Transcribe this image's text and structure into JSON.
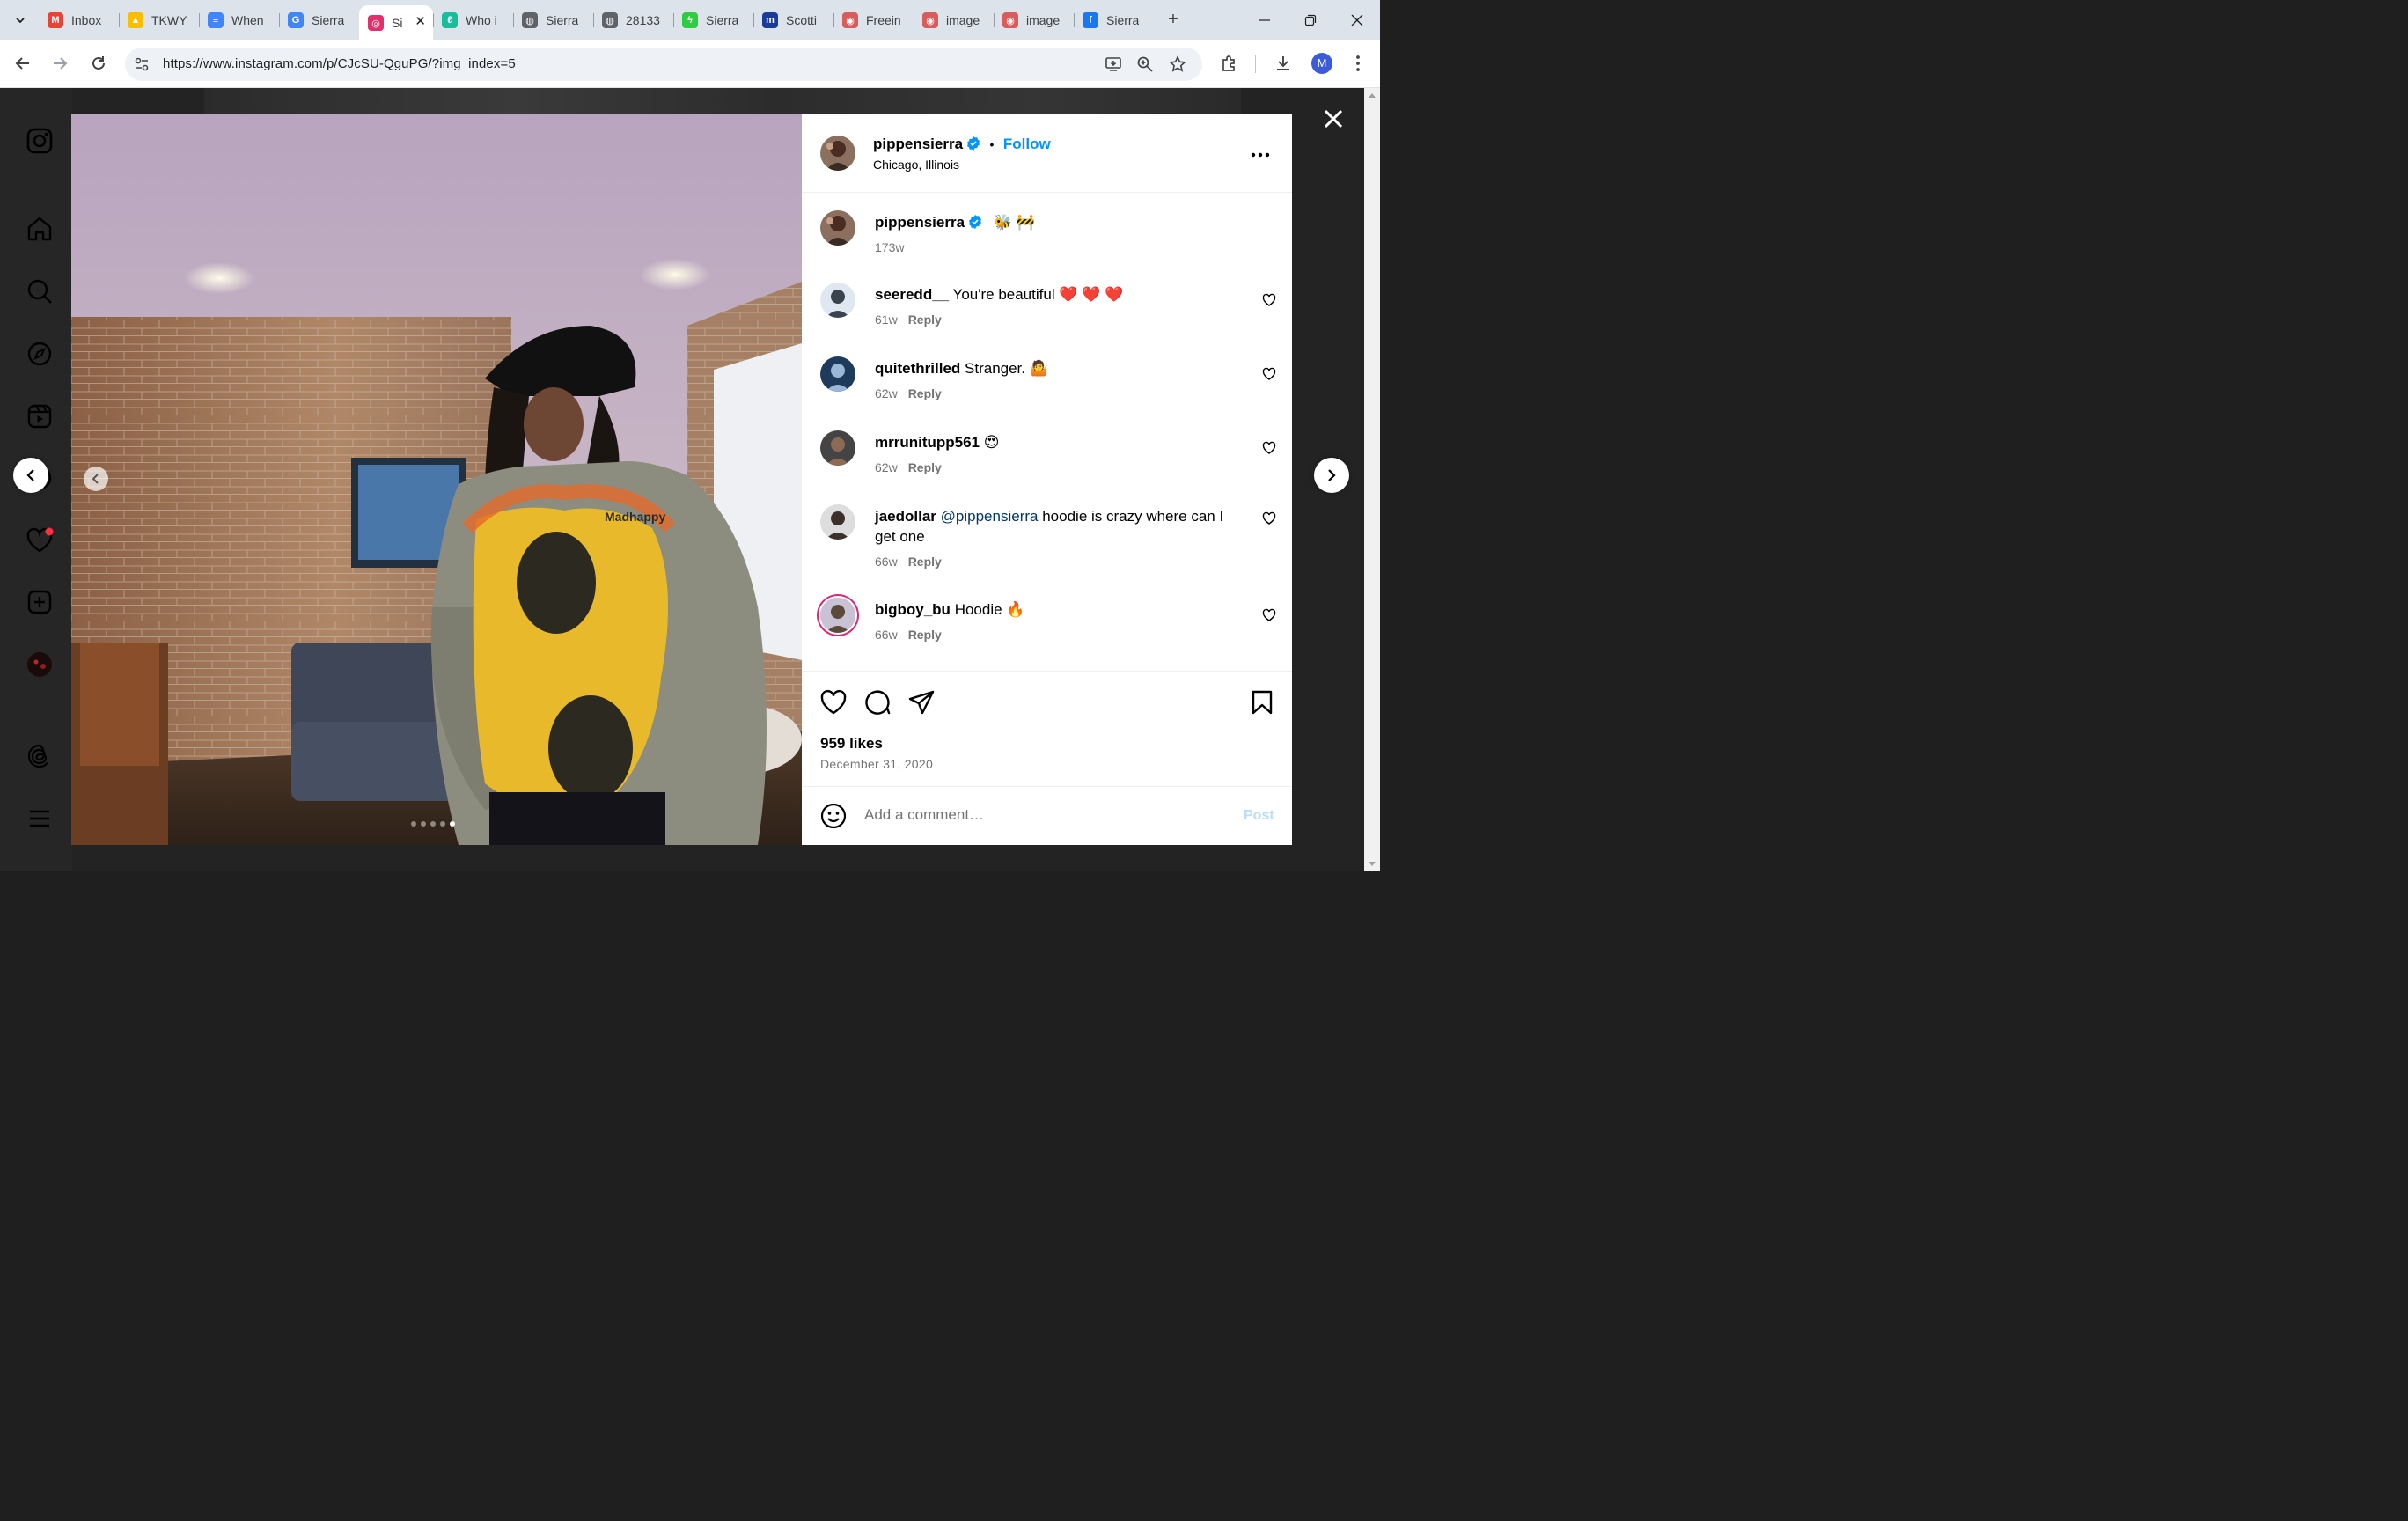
{
  "browser": {
    "tabs": [
      {
        "label": "Inbox",
        "icon": "gmail-icon",
        "color": "#ea4335"
      },
      {
        "label": "TKWY",
        "icon": "google-drive-icon",
        "color": "#fbbc04"
      },
      {
        "label": "When",
        "icon": "google-docs-icon",
        "color": "#4285f4"
      },
      {
        "label": "Sierra",
        "icon": "google-icon",
        "color": "#4285f4"
      },
      {
        "label": "Si",
        "icon": "instagram-icon",
        "color": "#e1306c",
        "active": true
      },
      {
        "label": "Who i",
        "icon": "leaf-icon",
        "color": "#1abc9c"
      },
      {
        "label": "Sierra",
        "icon": "globe-icon",
        "color": "#5f6368"
      },
      {
        "label": "28133",
        "icon": "globe-icon",
        "color": "#5f6368"
      },
      {
        "label": "Sierra",
        "icon": "bolt-icon",
        "color": "#2ecc40"
      },
      {
        "label": "Scotti",
        "icon": "m-icon",
        "color": "#1a3a9c"
      },
      {
        "label": "Freein",
        "icon": "image-icon",
        "color": "#d95c5c"
      },
      {
        "label": "image",
        "icon": "image-icon",
        "color": "#d95c5c"
      },
      {
        "label": "image",
        "icon": "image-icon",
        "color": "#d95c5c"
      },
      {
        "label": "Sierra",
        "icon": "facebook-icon",
        "color": "#1877f2"
      }
    ],
    "url": "https://www.instagram.com/p/CJcSU-QguPG/?img_index=5",
    "profile_initial": "M"
  },
  "post": {
    "author": "pippensierra",
    "follow_label": "Follow",
    "separator": "•",
    "location": "Chicago, Illinois",
    "caption_emojis": "🐝 🚧",
    "caption_age": "173w",
    "likes": "959 likes",
    "date": "December 31, 2020",
    "add_comment_placeholder": "Add a comment…",
    "post_label": "Post",
    "photo_text": "Madhappy",
    "carousel": {
      "count": 5,
      "active_index": 5
    }
  },
  "comments": [
    {
      "user": "seeredd__",
      "text": "You're beautiful ❤️ ❤️ ❤️",
      "age": "61w",
      "reply": "Reply"
    },
    {
      "user": "quitethrilled",
      "text": "Stranger. 🤷",
      "age": "62w",
      "reply": "Reply"
    },
    {
      "user": "mrrunitupp561",
      "text": "😍",
      "age": "62w",
      "reply": "Reply"
    },
    {
      "user": "jaedollar",
      "mention": "@pippensierra",
      "text": "hoodie is crazy where can I get one",
      "age": "66w",
      "reply": "Reply"
    },
    {
      "user": "bigboy_bu",
      "text": "Hoodie 🔥",
      "age": "66w",
      "reply": "Reply"
    }
  ],
  "colors": {
    "follow_blue": "#0095f6",
    "verified_blue": "#0095f6",
    "mention_blue": "#00376b",
    "notification_red": "#ff3040"
  }
}
